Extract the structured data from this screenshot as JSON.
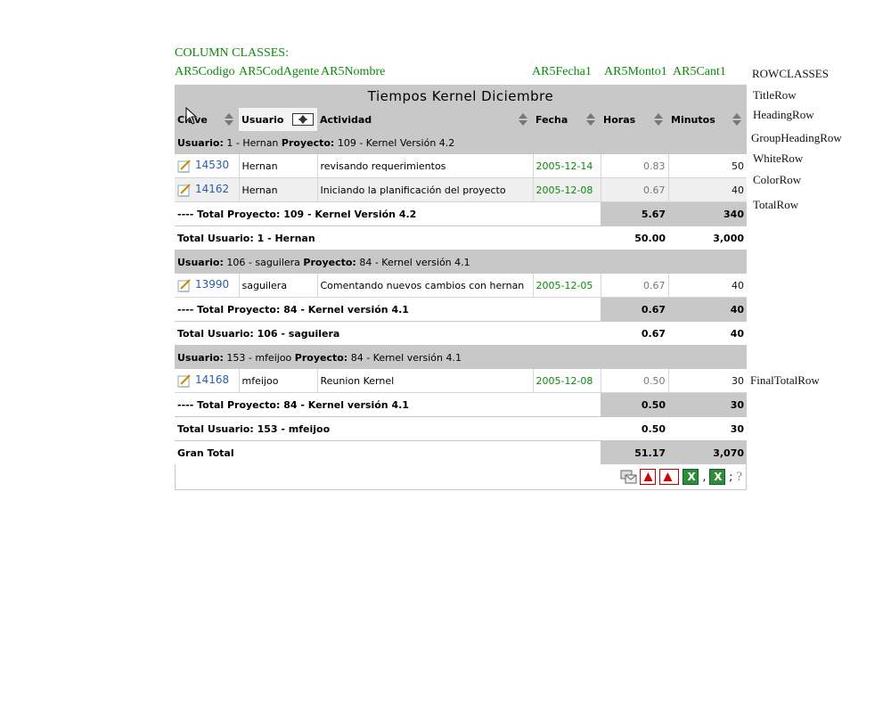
{
  "column_classes": {
    "title": "COLUMN CLASSES:",
    "items": [
      "AR5Codigo",
      "AR5CodAgente",
      "AR5Nombre",
      "AR5Fecha1",
      "AR5Monto1",
      "AR5Cant1"
    ]
  },
  "row_classes": {
    "title": "ROWCLASSES",
    "items": [
      "TitleRow",
      "HeadingRow",
      "GroupHeadingRow",
      "WhiteRow",
      "ColorRow",
      "TotalRow",
      "FinalTotalRow"
    ]
  },
  "report": {
    "title": "Tiempos Kernel Diciembre",
    "headers": [
      "Clave",
      "Usuario",
      "Actividad",
      "Fecha",
      "Horas",
      "Minutos"
    ],
    "groups": [
      {
        "heading_user_label": "Usuario:",
        "heading_user": "1 - Hernan",
        "heading_project_label": "Proyecto:",
        "heading_project": "109 - Kernel Versión 4.2",
        "rows": [
          {
            "clave": "14530",
            "usuario": "Hernan",
            "actividad": "revisando requerimientos",
            "fecha": "2005-12-14",
            "horas": "0.83",
            "minutos": "50"
          },
          {
            "clave": "14162",
            "usuario": "Hernan",
            "actividad": "Iniciando la planificación del proyecto",
            "fecha": "2005-12-08",
            "horas": "0.67",
            "minutos": "40"
          }
        ],
        "project_total_label": "---- Total Proyecto: 109 - Kernel Versión 4.2",
        "project_total_horas": "5.67",
        "project_total_minutos": "340",
        "user_total_label": "Total Usuario: 1 - Hernan",
        "user_total_horas": "50.00",
        "user_total_minutos": "3,000"
      },
      {
        "heading_user_label": "Usuario:",
        "heading_user": "106 - saguilera",
        "heading_project_label": "Proyecto:",
        "heading_project": "84 - Kernel versión 4.1",
        "rows": [
          {
            "clave": "13990",
            "usuario": "saguilera",
            "actividad": "Comentando nuevos cambios con hernan",
            "fecha": "2005-12-05",
            "horas": "0.67",
            "minutos": "40"
          }
        ],
        "project_total_label": "---- Total Proyecto: 84 - Kernel versión 4.1",
        "project_total_horas": "0.67",
        "project_total_minutos": "40",
        "user_total_label": "Total Usuario: 106 - saguilera",
        "user_total_horas": "0.67",
        "user_total_minutos": "40"
      },
      {
        "heading_user_label": "Usuario:",
        "heading_user": "153 - mfeijoo",
        "heading_project_label": "Proyecto:",
        "heading_project": "84 - Kernel versión 4.1",
        "rows": [
          {
            "clave": "14168",
            "usuario": "mfeijoo",
            "actividad": "Reunion Kernel",
            "fecha": "2005-12-08",
            "horas": "0.50",
            "minutos": "30"
          }
        ],
        "project_total_label": "---- Total Proyecto: 84 - Kernel versión 4.1",
        "project_total_horas": "0.50",
        "project_total_minutos": "30",
        "user_total_label": "Total Usuario: 153 - mfeijoo",
        "user_total_horas": "0.50",
        "user_total_minutos": "30"
      }
    ],
    "grand_total_label": "Gran Total",
    "grand_total_horas": "51.17",
    "grand_total_minutos": "3,070"
  },
  "toolbar": {
    "icons": [
      "email-icon",
      "pdf-icon",
      "pdf-landscape-icon",
      "excel-icon",
      "excel-csv-icon",
      "help-icon"
    ],
    "excel_sep1": ",",
    "excel_sep2": ";",
    "help_glyph": "?"
  },
  "colors": {
    "accent_green": "#0a8a0a",
    "link_blue": "#2a5da8",
    "gray_band": "#c8c8c8"
  }
}
